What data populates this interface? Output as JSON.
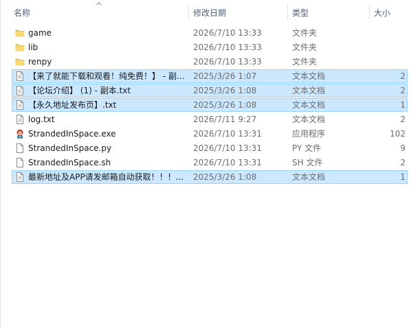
{
  "header": {
    "name": "名称",
    "date": "修改日期",
    "type": "类型",
    "size": "大小"
  },
  "files": [
    {
      "name": "game",
      "date": "2026/7/10 13:33",
      "type": "文件夹",
      "size": "",
      "icon": "folder-icon",
      "selected": false
    },
    {
      "name": "lib",
      "date": "2026/7/10 13:33",
      "type": "文件夹",
      "size": "",
      "icon": "folder-icon",
      "selected": false
    },
    {
      "name": "renpy",
      "date": "2026/7/10 13:33",
      "type": "文件夹",
      "size": "",
      "icon": "folder-icon",
      "selected": false
    },
    {
      "name": "【来了就能下载和观看！纯免费！】 - 副...",
      "date": "2025/3/26 1:07",
      "type": "文本文档",
      "size": "2",
      "icon": "text-file-icon",
      "selected": true
    },
    {
      "name": "【论坛介绍】 (1) - 副本.txt",
      "date": "2025/3/26 1:08",
      "type": "文本文档",
      "size": "2",
      "icon": "text-file-icon",
      "selected": true
    },
    {
      "name": "【永久地址发布页】.txt",
      "date": "2025/3/26 1:08",
      "type": "文本文档",
      "size": "1",
      "icon": "text-file-icon",
      "selected": true
    },
    {
      "name": "log.txt",
      "date": "2026/7/11 9:27",
      "type": "文本文档",
      "size": "2",
      "icon": "text-file-icon",
      "selected": false
    },
    {
      "name": "StrandedInSpace.exe",
      "date": "2026/7/10 13:31",
      "type": "应用程序",
      "size": "102",
      "icon": "app-icon",
      "selected": false
    },
    {
      "name": "StrandedInSpace.py",
      "date": "2026/7/10 13:31",
      "type": "PY 文件",
      "size": "9",
      "icon": "blank-file-icon",
      "selected": false
    },
    {
      "name": "StrandedInSpace.sh",
      "date": "2026/7/10 13:31",
      "type": "SH 文件",
      "size": "2",
      "icon": "blank-file-icon",
      "selected": false
    },
    {
      "name": "最新地址及APP请发邮箱自动获取！！！...",
      "date": "2025/3/26 1:08",
      "type": "文本文档",
      "size": "1",
      "icon": "text-file-icon",
      "selected": true
    }
  ]
}
